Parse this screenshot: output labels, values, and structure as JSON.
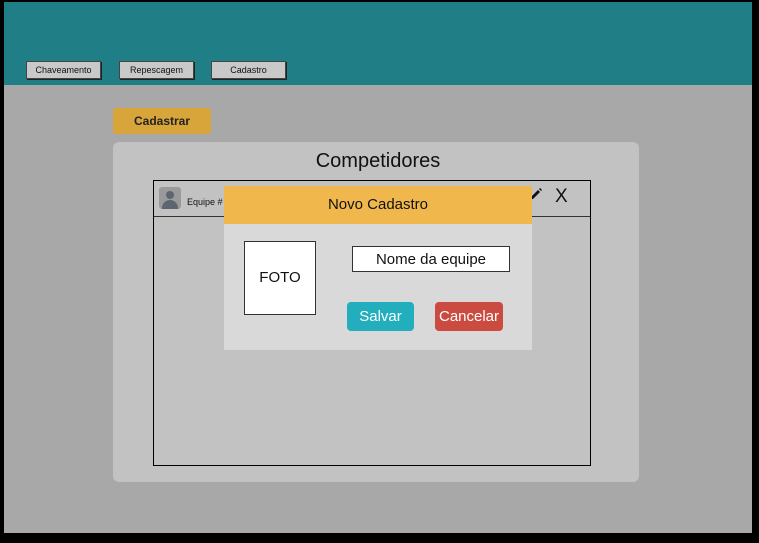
{
  "nav": {
    "items": [
      {
        "label": "Chaveamento"
      },
      {
        "label": "Repescagem"
      },
      {
        "label": "Cadastro"
      }
    ]
  },
  "actions": {
    "cadastrar_label": "Cadastrar"
  },
  "panel": {
    "title": "Competidores",
    "row": {
      "label": "Equipe #",
      "icons": {
        "avatar": "user-avatar-icon",
        "edit": "pencil-icon",
        "delete": "close-icon"
      },
      "delete_label": "X"
    }
  },
  "modal": {
    "title": "Novo Cadastro",
    "photo_label": "FOTO",
    "name_placeholder": "Nome da equipe",
    "save_label": "Salvar",
    "cancel_label": "Cancelar"
  },
  "colors": {
    "topbar": "#1f7e86",
    "cadastrar": "#d7a53a",
    "modal_header": "#f0b84c",
    "save": "#23aebe",
    "cancel": "#cc4b40"
  }
}
